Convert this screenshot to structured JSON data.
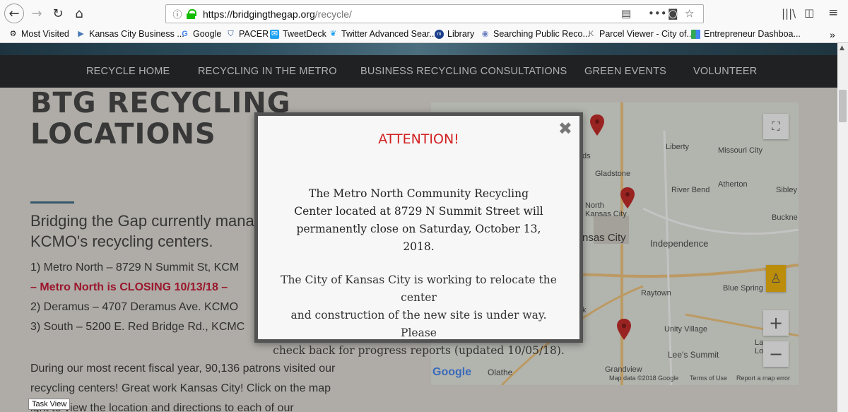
{
  "browser": {
    "url_host": "https://bridgingthegap.org",
    "url_path": "/recycle/",
    "bookmarks": [
      "Most Visited",
      "Kansas City Business ...",
      "Google",
      "PACER",
      "TweetDeck",
      "Twitter Advanced Sear...",
      "Library",
      "Searching Public Reco...",
      "Parcel Viewer - City of...",
      "Entrepreneur Dashboa..."
    ]
  },
  "nav": [
    "RECYCLE HOME",
    "RECYCLING IN THE METRO",
    "BUSINESS RECYCLING CONSULTATIONS",
    "GREEN EVENTS",
    "VOLUNTEER"
  ],
  "page": {
    "title_line1": "BTG RECYCLING",
    "title_line2": "LOCATIONS",
    "intro_line1": "Bridging the Gap currently mana",
    "intro_line2": "KCMO's recycling centers.",
    "loc1": "1) Metro North – 8729 N Summit St, KCM",
    "closing": "– Metro North is CLOSING 10/13/18 –",
    "loc2": "2) Deramus – 4707 Deramus Ave. KCMO",
    "loc3": "3) South – 5200 E. Red Bridge Rd., KCMC",
    "para_line1": "During our most recent fiscal year, 90,136 patrons visited our",
    "para_line2": "recycling centers! Great work Kansas City! Click on the map",
    "para_line3": "ight to view the location and directions to each of our"
  },
  "modal": {
    "heading": "ATTENTION!",
    "msg1_l1": "The Metro North Community Recycling",
    "msg1_l2": "Center located at 8729 N Summit Street will",
    "msg1_l3": "permanently close on Saturday, October 13, 2018.",
    "msg2_l1": "The City of Kansas City is working to relocate the center",
    "msg2_l2": "and construction of the new site is under way. Please",
    "msg2_l3": "check back for progress reports (updated 10/05/18).",
    "close": "✖"
  },
  "map": {
    "labels": [
      "Liberty",
      "Missouri City",
      "Gladstone",
      "River Bend",
      "Atherton",
      "Sibley",
      "North Kansas City",
      "Buckne",
      "nsas City",
      "Independence",
      "Raytown",
      "Blue Spring",
      "Unity Village",
      "Lee's Summit",
      "Grandview",
      "Olathe",
      "Lotaw",
      "La",
      "ds",
      "k"
    ],
    "attribution": "Map data ©2018 Google",
    "terms": "Terms of Use",
    "report": "Report a map error",
    "google": "Google"
  },
  "taskview": "Task View"
}
